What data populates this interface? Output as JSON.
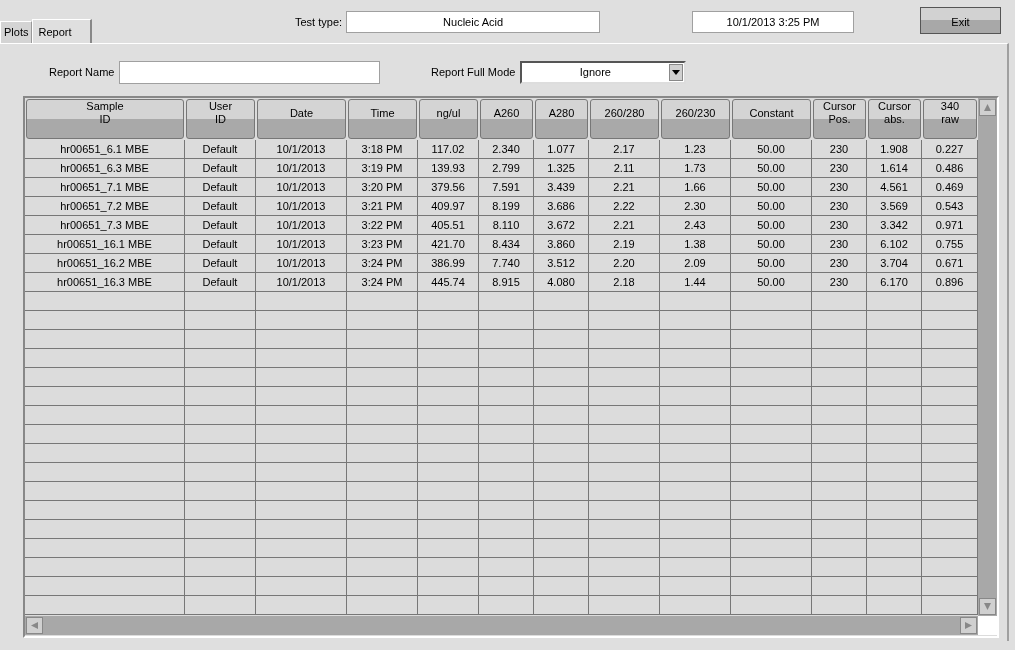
{
  "tabs": [
    {
      "label": "Plots",
      "selected": false
    },
    {
      "label": "Report",
      "selected": true
    }
  ],
  "test_type": {
    "label": "Test type:",
    "value": "Nucleic Acid"
  },
  "datetime": "10/1/2013  3:25 PM",
  "exit_button": "Exit",
  "report_name": {
    "label": "Report Name"
  },
  "report_full_mode": {
    "label": "Report Full Mode",
    "value": "Ignore"
  },
  "table": {
    "columns": [
      "Sample\nID",
      "User\nID",
      "Date",
      "Time",
      "ng/ul",
      "A260",
      "A280",
      "260/280",
      "260/230",
      "Constant",
      "Cursor\nPos.",
      "Cursor\nabs.",
      "340\nraw"
    ],
    "rows": [
      [
        "hr00651_6.1 MBE",
        "Default",
        "10/1/2013",
        "3:18 PM",
        "117.02",
        "2.340",
        "1.077",
        "2.17",
        "1.23",
        "50.00",
        "230",
        "1.908",
        "0.227"
      ],
      [
        "hr00651_6.3 MBE",
        "Default",
        "10/1/2013",
        "3:19 PM",
        "139.93",
        "2.799",
        "1.325",
        "2.11",
        "1.73",
        "50.00",
        "230",
        "1.614",
        "0.486"
      ],
      [
        "hr00651_7.1 MBE",
        "Default",
        "10/1/2013",
        "3:20 PM",
        "379.56",
        "7.591",
        "3.439",
        "2.21",
        "1.66",
        "50.00",
        "230",
        "4.561",
        "0.469"
      ],
      [
        "hr00651_7.2 MBE",
        "Default",
        "10/1/2013",
        "3:21 PM",
        "409.97",
        "8.199",
        "3.686",
        "2.22",
        "2.30",
        "50.00",
        "230",
        "3.569",
        "0.543"
      ],
      [
        "hr00651_7.3 MBE",
        "Default",
        "10/1/2013",
        "3:22 PM",
        "405.51",
        "8.110",
        "3.672",
        "2.21",
        "2.43",
        "50.00",
        "230",
        "3.342",
        "0.971"
      ],
      [
        "hr00651_16.1 MBE",
        "Default",
        "10/1/2013",
        "3:23 PM",
        "421.70",
        "8.434",
        "3.860",
        "2.19",
        "1.38",
        "50.00",
        "230",
        "6.102",
        "0.755"
      ],
      [
        "hr00651_16.2 MBE",
        "Default",
        "10/1/2013",
        "3:24 PM",
        "386.99",
        "7.740",
        "3.512",
        "2.20",
        "2.09",
        "50.00",
        "230",
        "3.704",
        "0.671"
      ],
      [
        "hr00651_16.3 MBE",
        "Default",
        "10/1/2013",
        "3:24 PM",
        "445.74",
        "8.915",
        "4.080",
        "2.18",
        "1.44",
        "50.00",
        "230",
        "6.170",
        "0.896"
      ]
    ]
  }
}
